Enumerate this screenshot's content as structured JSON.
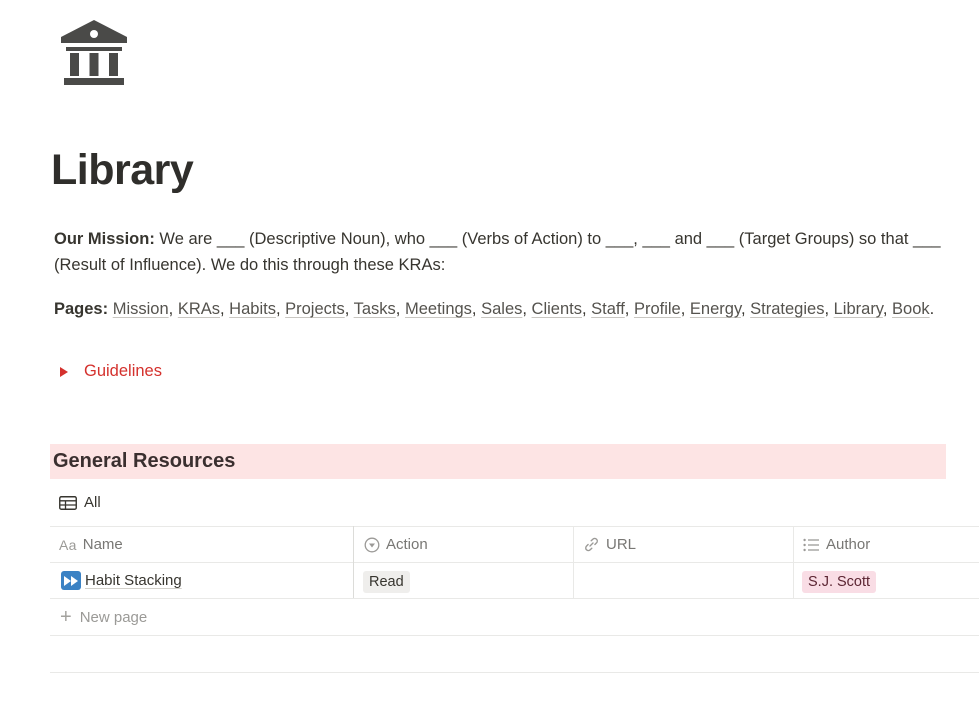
{
  "page": {
    "icon": "bank-building-icon",
    "title": "Library"
  },
  "mission": {
    "label": "Our Mission:",
    "text": " We are ___ (Descriptive Noun), who ___ (Verbs of Action) to ___, ___  and ___  (Target Groups) so that ___ (Result of Influence). We do this through these KRAs:"
  },
  "pages_nav": {
    "label": "Pages:",
    "links": [
      "Mission",
      "KRAs",
      "Habits",
      "Projects",
      "Tasks",
      "Meetings",
      "Sales",
      "Clients",
      "Staff",
      "Profile",
      "Energy",
      "Strategies",
      "Library",
      "Book"
    ],
    "separator": ", ",
    "end": "."
  },
  "toggle": {
    "label": "Guidelines",
    "color": "#d4312d"
  },
  "section": {
    "heading": "General Resources",
    "background": "#fde4e4"
  },
  "database": {
    "view_label": "All",
    "columns": [
      {
        "label": "Name",
        "icon": "Aa"
      },
      {
        "label": "Action",
        "icon": "select-icon"
      },
      {
        "label": "URL",
        "icon": "link-icon"
      },
      {
        "label": "Author",
        "icon": "multi-select-icon"
      }
    ],
    "rows": [
      {
        "name": "Habit Stacking",
        "icon": "fast-forward-icon",
        "action": "Read",
        "url": "",
        "author": "S.J. Scott"
      }
    ],
    "new_page_label": "New page"
  }
}
